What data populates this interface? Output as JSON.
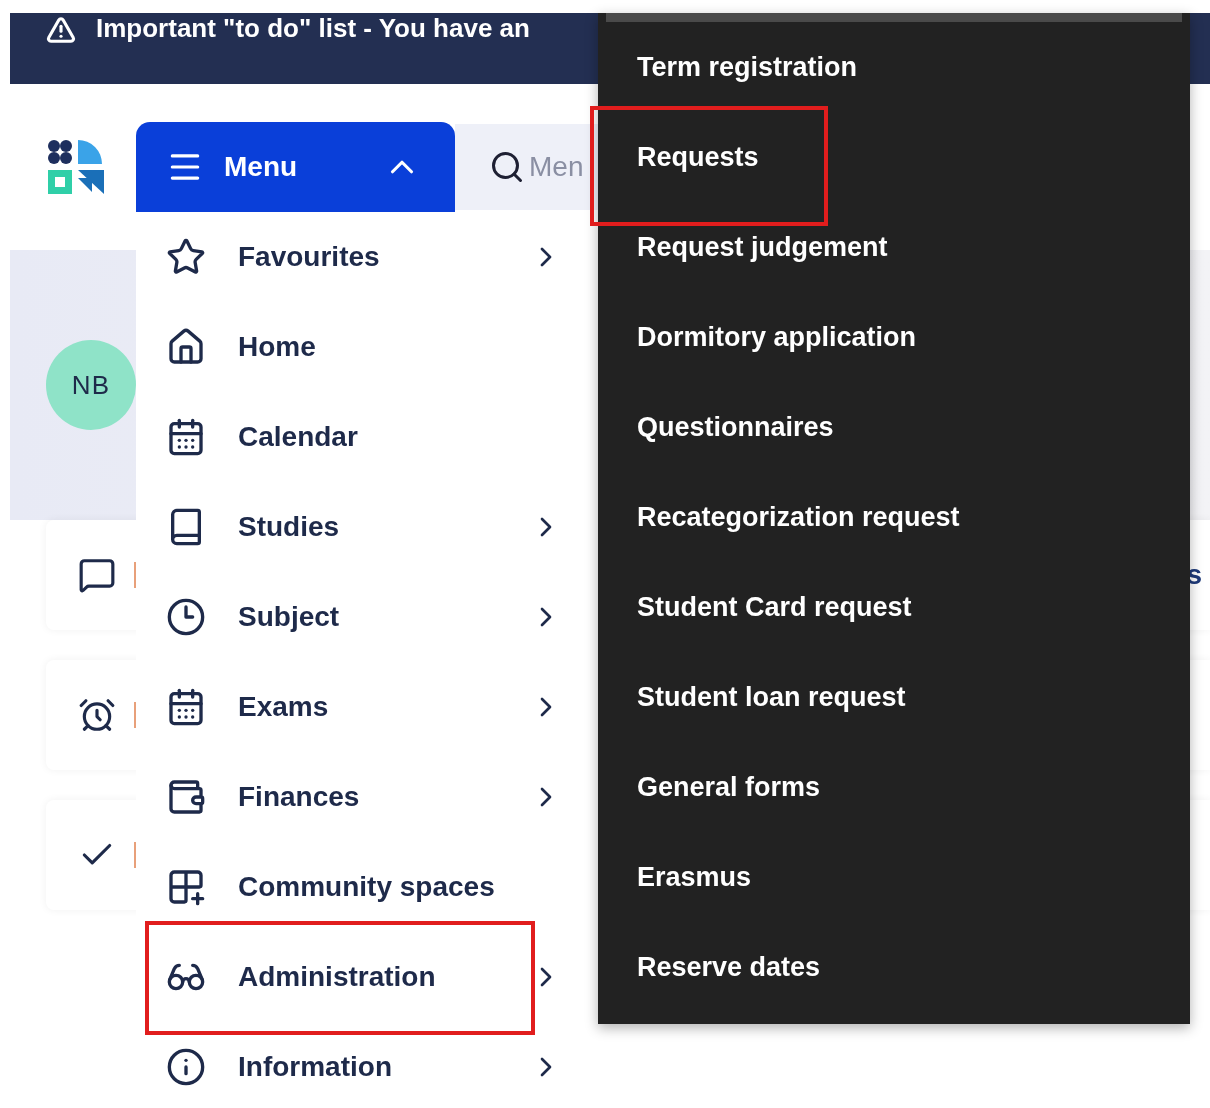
{
  "banner": {
    "text": "Important \"to do\" list - You have an"
  },
  "menu_button": {
    "label": "Menu",
    "expanded": true
  },
  "search": {
    "placeholder": "Men"
  },
  "avatar": {
    "initials": "NB"
  },
  "cards": [
    {
      "kind": "message",
      "text": "s"
    },
    {
      "kind": "alarm"
    },
    {
      "kind": "check"
    }
  ],
  "menu": {
    "items": [
      {
        "label": "Favourites",
        "kind": "star",
        "has_submenu": true,
        "highlighted": false
      },
      {
        "label": "Home",
        "kind": "home",
        "has_submenu": false,
        "highlighted": false
      },
      {
        "label": "Calendar",
        "kind": "calendar",
        "has_submenu": false,
        "highlighted": false
      },
      {
        "label": "Studies",
        "kind": "book",
        "has_submenu": true,
        "highlighted": false
      },
      {
        "label": "Subject",
        "kind": "clock",
        "has_submenu": true,
        "highlighted": false
      },
      {
        "label": "Exams",
        "kind": "calendar",
        "has_submenu": true,
        "highlighted": false
      },
      {
        "label": "Finances",
        "kind": "wallet",
        "has_submenu": true,
        "highlighted": false
      },
      {
        "label": "Community spaces",
        "kind": "grid",
        "has_submenu": false,
        "highlighted": false
      },
      {
        "label": "Administration",
        "kind": "glasses",
        "has_submenu": true,
        "highlighted": true
      },
      {
        "label": "Information",
        "kind": "info",
        "has_submenu": true,
        "highlighted": false
      }
    ]
  },
  "submenu": {
    "items": [
      {
        "label": "Term registration",
        "highlighted": false
      },
      {
        "label": "Requests",
        "highlighted": true
      },
      {
        "label": "Request judgement",
        "highlighted": false
      },
      {
        "label": "Dormitory application",
        "highlighted": false
      },
      {
        "label": "Questionnaires",
        "highlighted": false
      },
      {
        "label": "Recategorization request",
        "highlighted": false
      },
      {
        "label": "Student Card request",
        "highlighted": false
      },
      {
        "label": "Student loan request",
        "highlighted": false
      },
      {
        "label": "General forms",
        "highlighted": false
      },
      {
        "label": "Erasmus",
        "highlighted": false
      },
      {
        "label": "Reserve dates",
        "highlighted": false
      }
    ]
  }
}
